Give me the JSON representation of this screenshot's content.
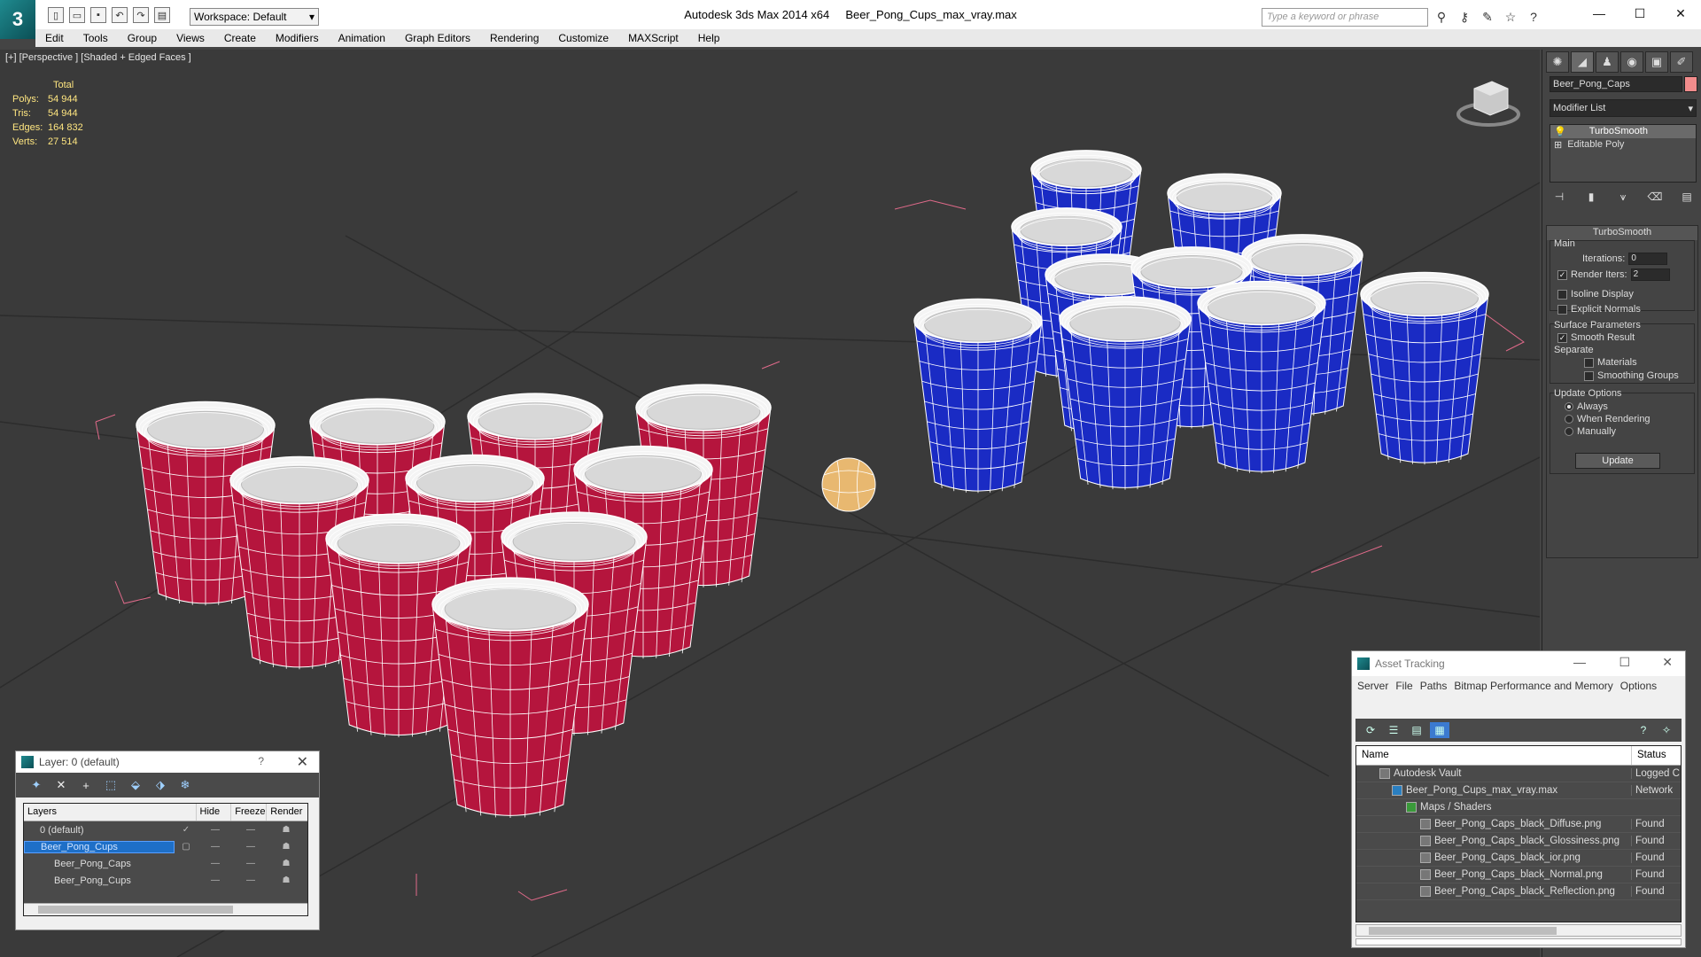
{
  "titlebar": {
    "app_title": "Autodesk 3ds Max  2014 x64",
    "file_name": "Beer_Pong_Cups_max_vray.max",
    "workspace": "Workspace: Default",
    "search_placeholder": "Type a keyword or phrase",
    "minimize": "—",
    "maximize": "☐",
    "close": "✕"
  },
  "menu": [
    "Edit",
    "Tools",
    "Group",
    "Views",
    "Create",
    "Modifiers",
    "Animation",
    "Graph Editors",
    "Rendering",
    "Customize",
    "MAXScript",
    "Help"
  ],
  "viewport": {
    "label": "[+] [Perspective ] [Shaded + Edged Faces ]",
    "stats_header": "Total",
    "stats": [
      {
        "label": "Polys:",
        "value": "54 944"
      },
      {
        "label": "Tris:",
        "value": "54 944"
      },
      {
        "label": "Edges:",
        "value": "164 832"
      },
      {
        "label": "Verts:",
        "value": "27 514"
      }
    ]
  },
  "command_panel": {
    "object_name": "Beer_Pong_Caps",
    "object_color": "#f28c8c",
    "modifier_list": "Modifier List",
    "stack": [
      "TurboSmooth",
      "Editable Poly"
    ],
    "rollout_title": "TurboSmooth",
    "main_label": "Main",
    "iterations_label": "Iterations:",
    "iterations_value": "0",
    "render_iters_label": "Render Iters:",
    "render_iters_value": "2",
    "isoline_label": "Isoline Display",
    "explicit_normals_label": "Explicit Normals",
    "surface_params_label": "Surface Parameters",
    "smooth_result_label": "Smooth Result",
    "separate_label": "Separate",
    "materials_label": "Materials",
    "smoothing_groups_label": "Smoothing Groups",
    "update_options_label": "Update Options",
    "always_label": "Always",
    "when_rendering_label": "When Rendering",
    "manually_label": "Manually",
    "update_button": "Update"
  },
  "layer_dialog": {
    "title": "Layer: 0 (default)",
    "help": "?",
    "close": "✕",
    "columns": [
      "Layers",
      "Hide",
      "Freeze",
      "Render"
    ],
    "rows": [
      {
        "name": "0 (default)",
        "indent": 0
      },
      {
        "name": "Beer_Pong_Cups",
        "indent": 0
      },
      {
        "name": "Beer_Pong_Caps",
        "indent": 1
      },
      {
        "name": "Beer_Pong_Cups",
        "indent": 1
      }
    ]
  },
  "asset_dialog": {
    "title": "Asset Tracking",
    "menu": [
      "Server",
      "File",
      "Paths",
      "Bitmap Performance and Memory",
      "Options"
    ],
    "columns": [
      "Name",
      "Status"
    ],
    "rows": [
      {
        "name": "Autodesk Vault",
        "status": "Logged C",
        "indent": 1
      },
      {
        "name": "Beer_Pong_Cups_max_vray.max",
        "status": "Network",
        "indent": 2
      },
      {
        "name": "Maps / Shaders",
        "status": "",
        "indent": 3
      },
      {
        "name": "Beer_Pong_Caps_black_Diffuse.png",
        "status": "Found",
        "indent": 4
      },
      {
        "name": "Beer_Pong_Caps_black_Glossiness.png",
        "status": "Found",
        "indent": 4
      },
      {
        "name": "Beer_Pong_Caps_black_ior.png",
        "status": "Found",
        "indent": 4
      },
      {
        "name": "Beer_Pong_Caps_black_Normal.png",
        "status": "Found",
        "indent": 4
      },
      {
        "name": "Beer_Pong_Caps_black_Reflection.png",
        "status": "Found",
        "indent": 4
      }
    ]
  },
  "colors": {
    "red_cup": "#b5153d",
    "blue_cup": "#1a2bc4",
    "ball": "#e8b870"
  }
}
